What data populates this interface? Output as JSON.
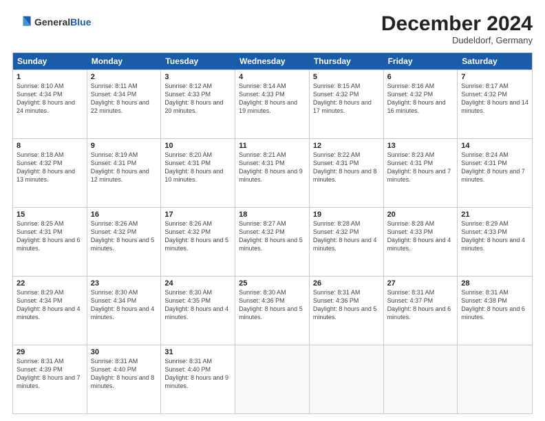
{
  "header": {
    "logo_general": "General",
    "logo_blue": "Blue",
    "month": "December 2024",
    "location": "Dudeldorf, Germany"
  },
  "days_of_week": [
    "Sunday",
    "Monday",
    "Tuesday",
    "Wednesday",
    "Thursday",
    "Friday",
    "Saturday"
  ],
  "weeks": [
    [
      {
        "day": "1",
        "sunrise": "8:10 AM",
        "sunset": "4:34 PM",
        "daylight": "8 hours and 24 minutes."
      },
      {
        "day": "2",
        "sunrise": "8:11 AM",
        "sunset": "4:34 PM",
        "daylight": "8 hours and 22 minutes."
      },
      {
        "day": "3",
        "sunrise": "8:12 AM",
        "sunset": "4:33 PM",
        "daylight": "8 hours and 20 minutes."
      },
      {
        "day": "4",
        "sunrise": "8:14 AM",
        "sunset": "4:33 PM",
        "daylight": "8 hours and 19 minutes."
      },
      {
        "day": "5",
        "sunrise": "8:15 AM",
        "sunset": "4:32 PM",
        "daylight": "8 hours and 17 minutes."
      },
      {
        "day": "6",
        "sunrise": "8:16 AM",
        "sunset": "4:32 PM",
        "daylight": "8 hours and 16 minutes."
      },
      {
        "day": "7",
        "sunrise": "8:17 AM",
        "sunset": "4:32 PM",
        "daylight": "8 hours and 14 minutes."
      }
    ],
    [
      {
        "day": "8",
        "sunrise": "8:18 AM",
        "sunset": "4:32 PM",
        "daylight": "8 hours and 13 minutes."
      },
      {
        "day": "9",
        "sunrise": "8:19 AM",
        "sunset": "4:31 PM",
        "daylight": "8 hours and 12 minutes."
      },
      {
        "day": "10",
        "sunrise": "8:20 AM",
        "sunset": "4:31 PM",
        "daylight": "8 hours and 10 minutes."
      },
      {
        "day": "11",
        "sunrise": "8:21 AM",
        "sunset": "4:31 PM",
        "daylight": "8 hours and 9 minutes."
      },
      {
        "day": "12",
        "sunrise": "8:22 AM",
        "sunset": "4:31 PM",
        "daylight": "8 hours and 8 minutes."
      },
      {
        "day": "13",
        "sunrise": "8:23 AM",
        "sunset": "4:31 PM",
        "daylight": "8 hours and 7 minutes."
      },
      {
        "day": "14",
        "sunrise": "8:24 AM",
        "sunset": "4:31 PM",
        "daylight": "8 hours and 7 minutes."
      }
    ],
    [
      {
        "day": "15",
        "sunrise": "8:25 AM",
        "sunset": "4:31 PM",
        "daylight": "8 hours and 6 minutes."
      },
      {
        "day": "16",
        "sunrise": "8:26 AM",
        "sunset": "4:32 PM",
        "daylight": "8 hours and 5 minutes."
      },
      {
        "day": "17",
        "sunrise": "8:26 AM",
        "sunset": "4:32 PM",
        "daylight": "8 hours and 5 minutes."
      },
      {
        "day": "18",
        "sunrise": "8:27 AM",
        "sunset": "4:32 PM",
        "daylight": "8 hours and 5 minutes."
      },
      {
        "day": "19",
        "sunrise": "8:28 AM",
        "sunset": "4:32 PM",
        "daylight": "8 hours and 4 minutes."
      },
      {
        "day": "20",
        "sunrise": "8:28 AM",
        "sunset": "4:33 PM",
        "daylight": "8 hours and 4 minutes."
      },
      {
        "day": "21",
        "sunrise": "8:29 AM",
        "sunset": "4:33 PM",
        "daylight": "8 hours and 4 minutes."
      }
    ],
    [
      {
        "day": "22",
        "sunrise": "8:29 AM",
        "sunset": "4:34 PM",
        "daylight": "8 hours and 4 minutes."
      },
      {
        "day": "23",
        "sunrise": "8:30 AM",
        "sunset": "4:34 PM",
        "daylight": "8 hours and 4 minutes."
      },
      {
        "day": "24",
        "sunrise": "8:30 AM",
        "sunset": "4:35 PM",
        "daylight": "8 hours and 4 minutes."
      },
      {
        "day": "25",
        "sunrise": "8:30 AM",
        "sunset": "4:36 PM",
        "daylight": "8 hours and 5 minutes."
      },
      {
        "day": "26",
        "sunrise": "8:31 AM",
        "sunset": "4:36 PM",
        "daylight": "8 hours and 5 minutes."
      },
      {
        "day": "27",
        "sunrise": "8:31 AM",
        "sunset": "4:37 PM",
        "daylight": "8 hours and 6 minutes."
      },
      {
        "day": "28",
        "sunrise": "8:31 AM",
        "sunset": "4:38 PM",
        "daylight": "8 hours and 6 minutes."
      }
    ],
    [
      {
        "day": "29",
        "sunrise": "8:31 AM",
        "sunset": "4:39 PM",
        "daylight": "8 hours and 7 minutes."
      },
      {
        "day": "30",
        "sunrise": "8:31 AM",
        "sunset": "4:40 PM",
        "daylight": "8 hours and 8 minutes."
      },
      {
        "day": "31",
        "sunrise": "8:31 AM",
        "sunset": "4:40 PM",
        "daylight": "8 hours and 9 minutes."
      },
      null,
      null,
      null,
      null
    ]
  ]
}
